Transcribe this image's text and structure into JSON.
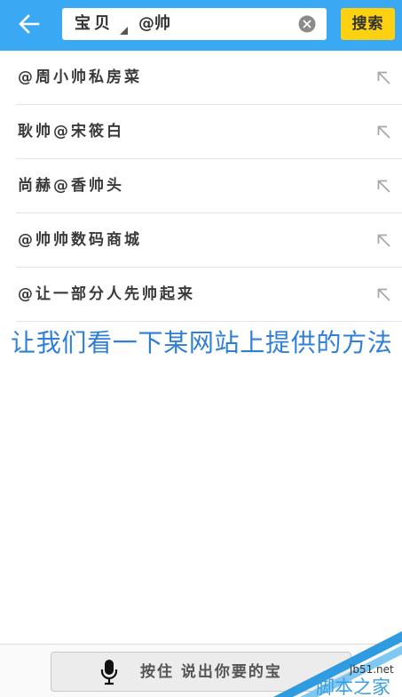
{
  "header": {
    "back_icon": "arrow-left-icon",
    "category_label": "宝贝",
    "category_dropdown_icon": "dropdown-triangle-icon",
    "query": "@帅",
    "clear_icon": "clear-icon",
    "search_button_label": "搜索"
  },
  "suggestions": [
    {
      "text": "@周小帅私房菜",
      "icon": "fill-query-arrow-icon"
    },
    {
      "text": "耿帅@宋筱白",
      "icon": "fill-query-arrow-icon"
    },
    {
      "text": "尚赫@香帅头",
      "icon": "fill-query-arrow-icon"
    },
    {
      "text": "@帅帅数码商城",
      "icon": "fill-query-arrow-icon"
    },
    {
      "text": "@让一部分人先帅起来",
      "icon": "fill-query-arrow-icon"
    }
  ],
  "caption": "让我们看一下某网站上提供的方法",
  "voice_search": {
    "label": "按住 说出你要的宝",
    "icon": "microphone-icon"
  },
  "watermark": {
    "site": "jb51.net",
    "name": "脚本之家"
  },
  "colors": {
    "header_bg": "#3aa8f3",
    "search_button_bg": "#fcd111",
    "caption": "#2f7fd6",
    "divider": "#e3e3e3",
    "watermark_blue": "#3a9ee0"
  }
}
